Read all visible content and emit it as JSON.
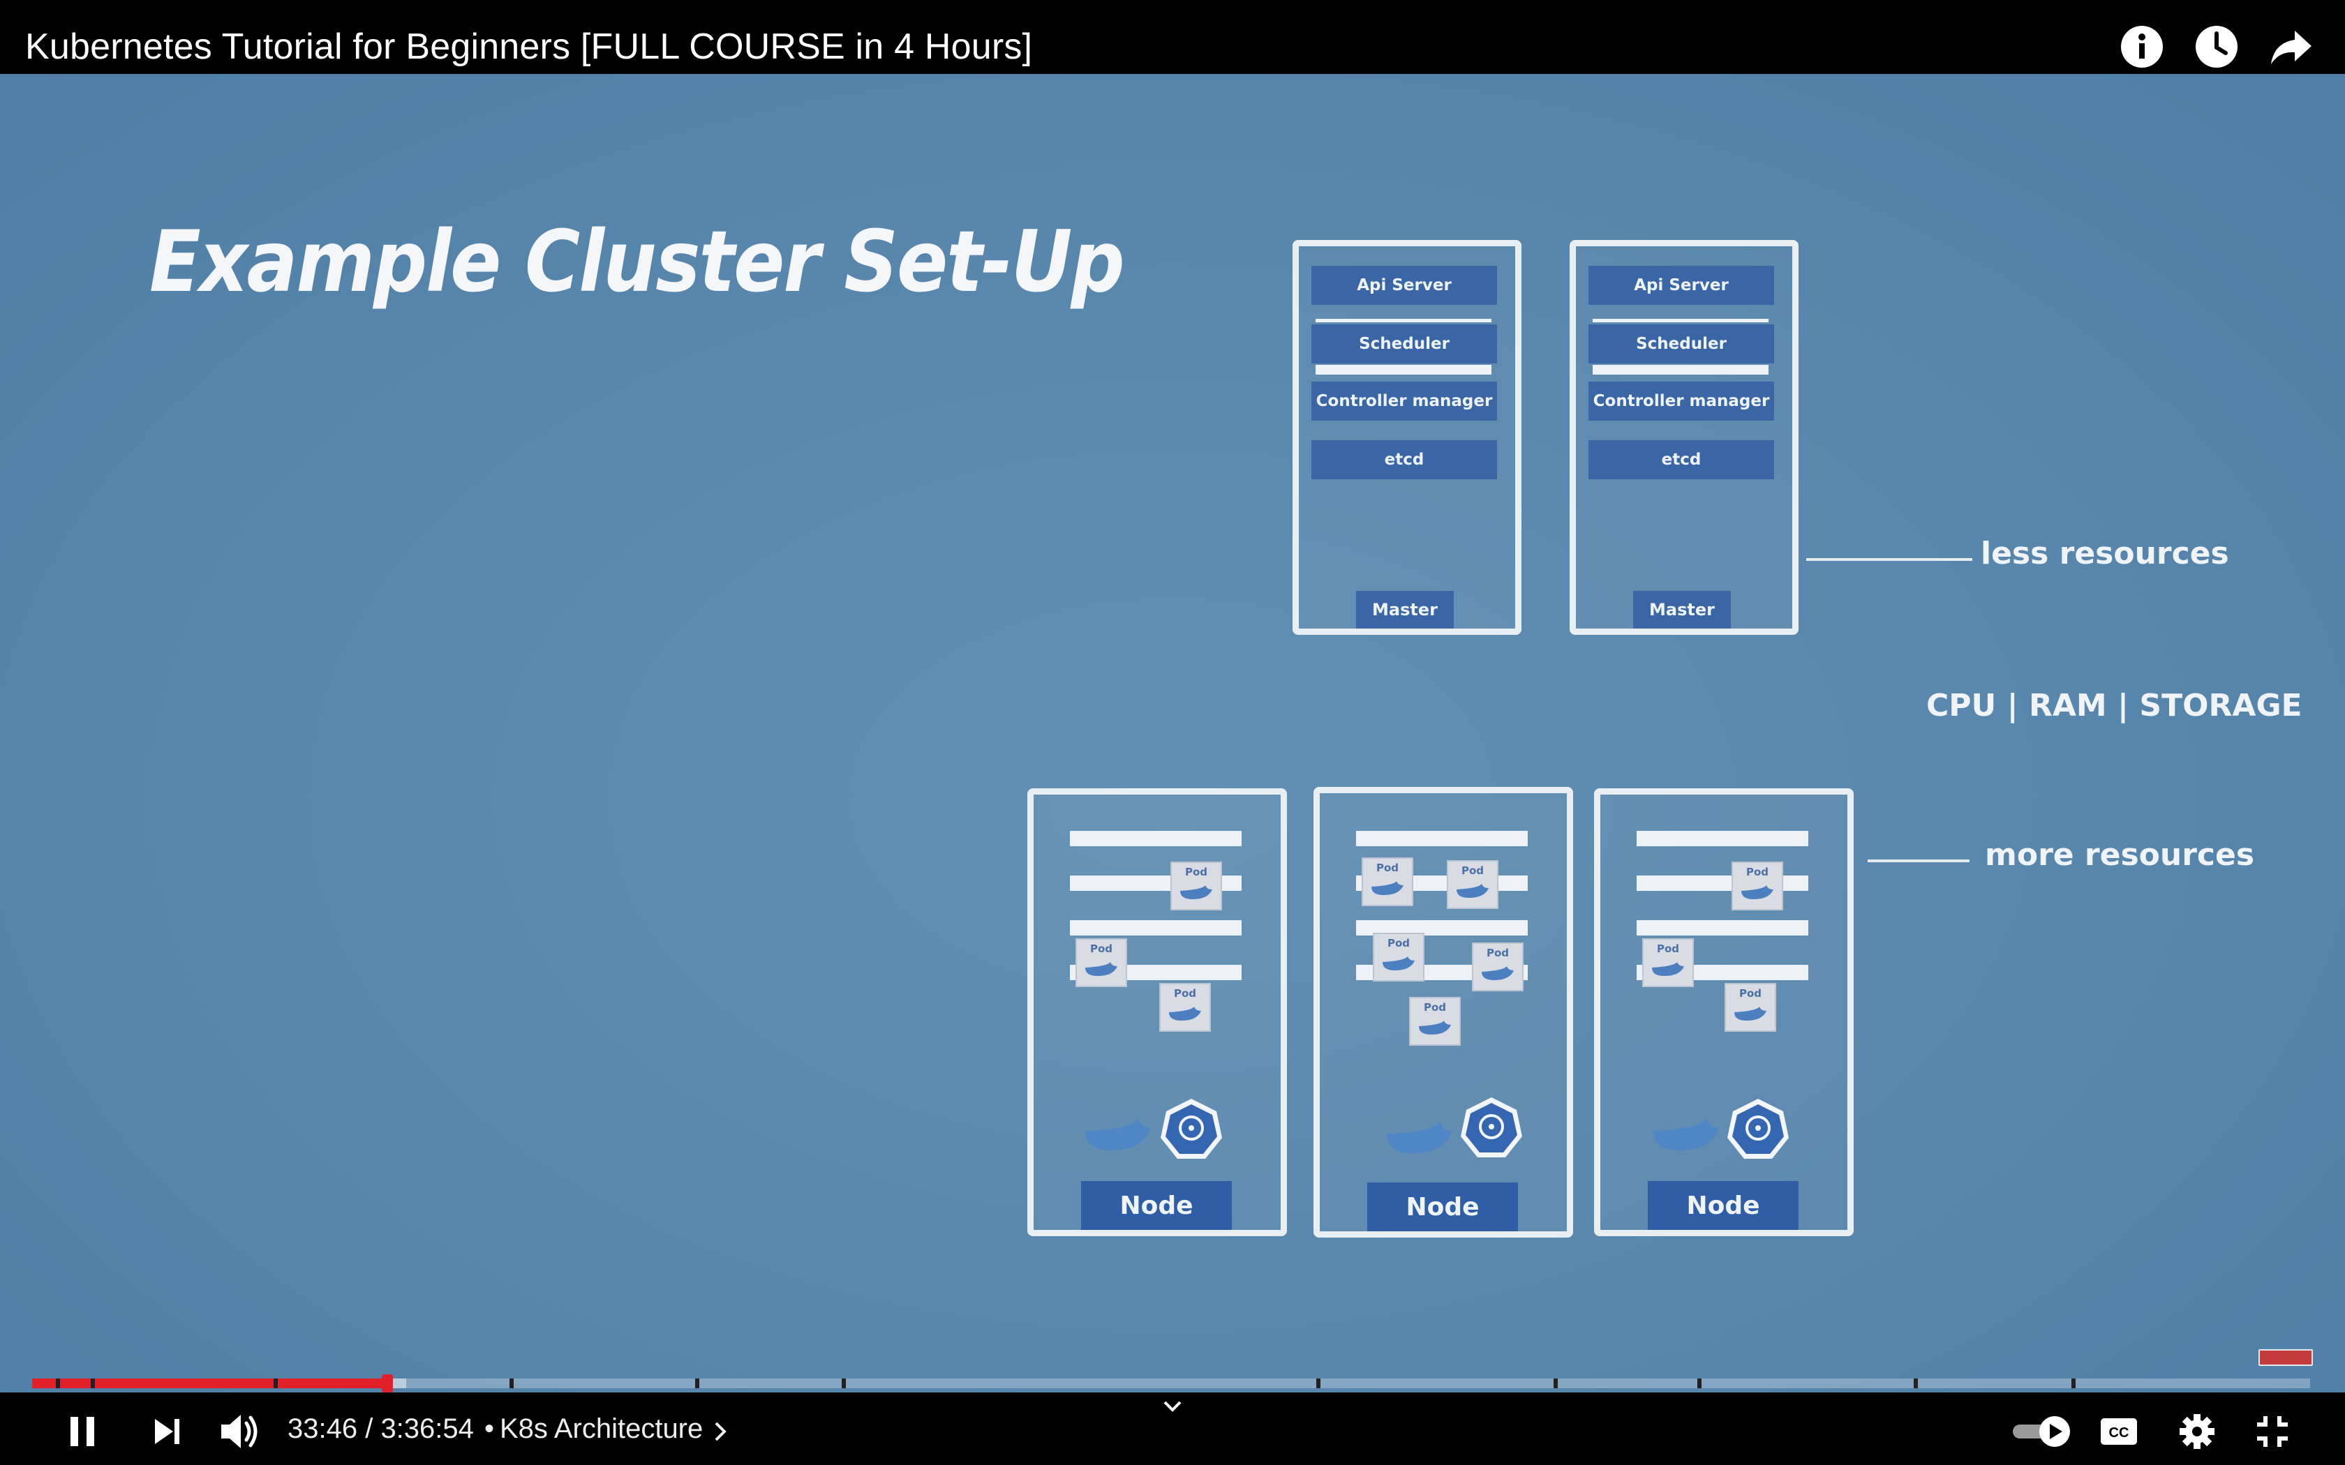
{
  "header": {
    "video_title": "Kubernetes Tutorial for Beginners [FULL COURSE in 4 Hours]",
    "icons": [
      "info-icon",
      "watch-later-icon",
      "share-icon"
    ]
  },
  "slide": {
    "title": "Example Cluster Set-Up",
    "masters": [
      {
        "components": [
          "Api Server",
          "Scheduler",
          "Controller manager",
          "etcd"
        ],
        "label": "Master"
      },
      {
        "components": [
          "Api Server",
          "Scheduler",
          "Controller manager",
          "etcd"
        ],
        "label": "Master"
      }
    ],
    "nodes": [
      {
        "label": "Node",
        "pods": [
          "Pod",
          "Pod",
          "Pod"
        ]
      },
      {
        "label": "Node",
        "pods": [
          "Pod",
          "Pod",
          "Pod",
          "Pod",
          "Pod"
        ]
      },
      {
        "label": "Node",
        "pods": [
          "Pod",
          "Pod",
          "Pod"
        ]
      }
    ],
    "annotations": {
      "less_resources": "less resources",
      "resources_types": "CPU | RAM | STORAGE",
      "more_resources": "more resources"
    }
  },
  "player": {
    "current_time": "33:46",
    "duration": "3:36:54",
    "time_display": "33:46 / 3:36:54",
    "separator": "•",
    "chapter": "K8s Architecture",
    "progress_played_fraction": 0.156,
    "accent_color": "#e1202a",
    "controls": {
      "pause": "pause-icon",
      "next": "next-icon",
      "volume": "volume-icon",
      "autoplay": "autoplay-toggle",
      "captions": "captions-icon",
      "settings": "settings-icon",
      "fullscreen_exit": "exit-fullscreen-icon"
    }
  }
}
